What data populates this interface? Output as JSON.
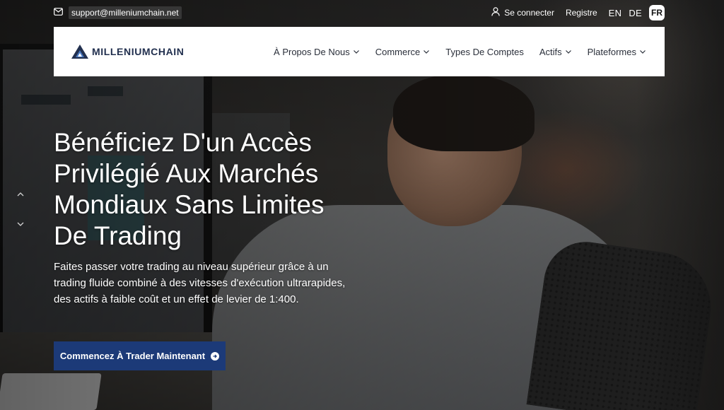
{
  "topbar": {
    "email": "support@milleniumchain.net",
    "login": "Se connecter",
    "register": "Registre",
    "languages": [
      "EN",
      "DE"
    ],
    "active_language": "FR"
  },
  "nav": {
    "logo": "MILLENIUMCHAIN",
    "items": [
      {
        "label": "À Propos De Nous",
        "dropdown": true
      },
      {
        "label": "Commerce",
        "dropdown": true
      },
      {
        "label": "Types De Comptes",
        "dropdown": false
      },
      {
        "label": "Actifs",
        "dropdown": true
      },
      {
        "label": "Plateformes",
        "dropdown": true
      }
    ]
  },
  "hero": {
    "title": "Bénéficiez D'un Accès Privilégié Aux Marchés Mondiaux Sans Limites De Trading",
    "subtitle": "Faites passer votre trading au niveau supérieur grâce à un trading fluide combiné à des vitesses d'exécution ultrarapides, des actifs à faible coût et un effet de levier de 1:400.",
    "cta": "Commencez À Trader Maintenant"
  },
  "colors": {
    "brand_navy": "#1c3a78",
    "logo_blue": "#22304f"
  },
  "icons": {
    "email": "envelope-icon",
    "login": "user-icon",
    "slider_up": "chevron-up-icon",
    "slider_down": "chevron-down-icon",
    "cta": "arrow-right-circle-icon"
  }
}
